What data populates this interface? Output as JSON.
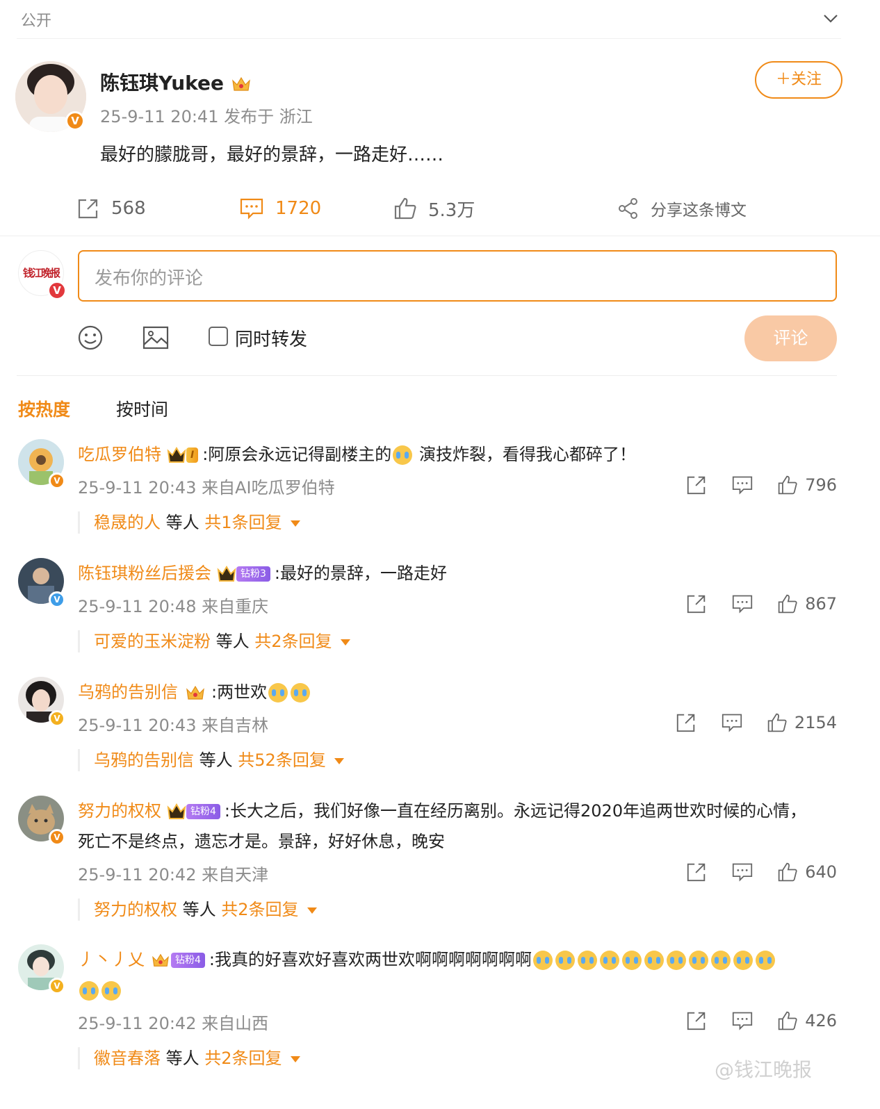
{
  "topbar": {
    "visibility": "公开"
  },
  "post": {
    "author": "陈钰琪Yukee",
    "meta": "25-9-11 20:41 发布于 浙江",
    "text": "最好的朦胧哥，最好的景辞，一路走好……",
    "follow_label": "＋关注"
  },
  "stats": {
    "reposts": "568",
    "comments": "1720",
    "likes": "5.3万",
    "share": "分享这条博文"
  },
  "composer": {
    "placeholder": "发布你的评论",
    "repost_label": "同时转发",
    "submit_label": "评论",
    "avatar_text": "钱江晚报"
  },
  "sort": {
    "hot": "按热度",
    "time": "按时间"
  },
  "comments": [
    {
      "user": "吃瓜罗伯特",
      "badge": "I",
      "badge_type": "gold",
      "text": ":阿原会永远记得副楼主的",
      "text_after": " 演技炸裂，看得我心都碎了！",
      "time": "25-9-11 20:43 来自AI吃瓜罗伯特",
      "likes": "796",
      "reply_user": "稳晟的人",
      "reply_mid": "等人",
      "reply_count": "共1条回复"
    },
    {
      "user": "陈钰琪粉丝后援会",
      "badge": "钻粉3",
      "badge_type": "purple",
      "text": ":最好的景辞，一路走好",
      "time": "25-9-11 20:48 来自重庆",
      "likes": "867",
      "reply_user": "可爱的玉米淀粉",
      "reply_mid": "等人",
      "reply_count": "共2条回复"
    },
    {
      "user": "乌鸦的告别信",
      "text": ":两世欢",
      "time": "25-9-11 20:43 来自吉林",
      "likes": "2154",
      "reply_user": "乌鸦的告别信",
      "reply_mid": "等人",
      "reply_count": "共52条回复"
    },
    {
      "user": "努力的权权",
      "badge": "钻粉4",
      "badge_type": "purple",
      "text": ":长大之后，我们好像一直在经历离别。永远记得2020年追两世欢时候的心情，",
      "text_line2": "死亡不是终点，遗忘才是。景辞，好好休息，晚安",
      "time": "25-9-11 20:42 来自天津",
      "likes": "640",
      "reply_user": "努力的权权",
      "reply_mid": "等人",
      "reply_count": "共2条回复"
    },
    {
      "user": "丿丶丿乂",
      "badge": "钻粉4",
      "badge_type": "purple",
      "text": ":我真的好喜欢好喜欢两世欢啊啊啊啊啊啊啊",
      "time": "25-9-11 20:42 来自山西",
      "likes": "426",
      "reply_user": "徽音春落",
      "reply_mid": "等人",
      "reply_count": "共2条回复"
    }
  ],
  "watermark": "@钱江晚报",
  "colors": {
    "accent": "#f08a17",
    "submit_disabled": "#f9c9a5",
    "muted": "#8c8c8c"
  }
}
